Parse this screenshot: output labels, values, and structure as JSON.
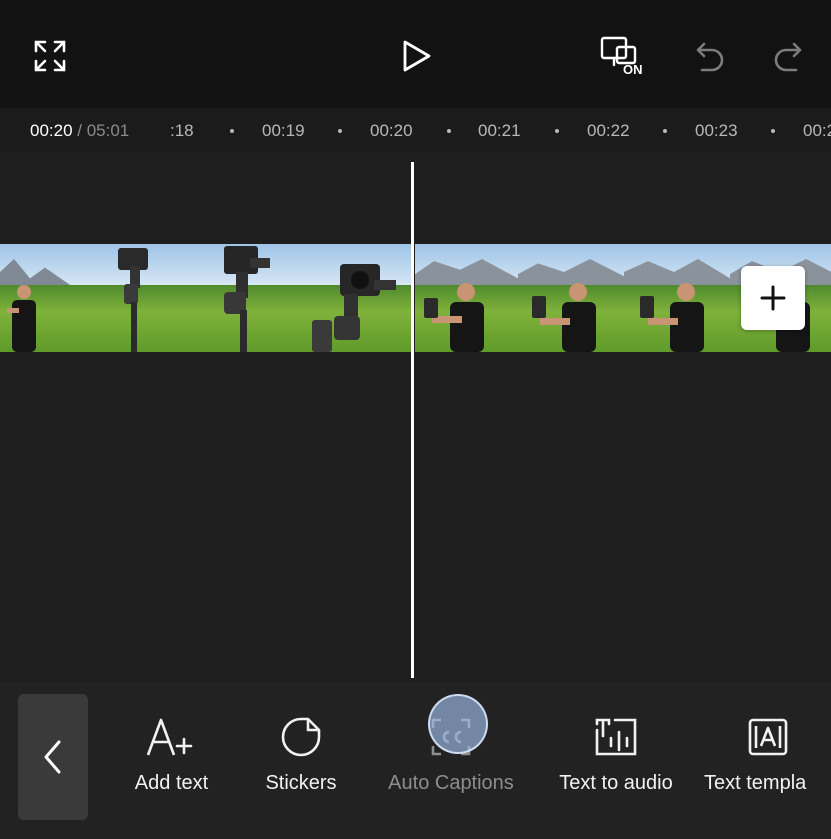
{
  "topbar": {
    "fullscreen_icon": "fullscreen-icon",
    "play_icon": "play-icon",
    "proxy_icon": "proxy-on-icon",
    "proxy_badge": "ON",
    "undo_icon": "undo-icon",
    "redo_icon": "redo-icon"
  },
  "timeline": {
    "current_time": "00:20",
    "separator": " / ",
    "total_time": "05:01",
    "ticks": [
      ":18",
      "00:19",
      "00:20",
      "00:21",
      "00:22",
      "00:23",
      "00:2"
    ]
  },
  "track": {
    "add_clip_icon": "plus-icon"
  },
  "toolbar": {
    "back_icon": "chevron-left-icon",
    "tools": [
      {
        "label": "Add text",
        "icon": "add-text-icon",
        "enabled": true
      },
      {
        "label": "Stickers",
        "icon": "sticker-icon",
        "enabled": true
      },
      {
        "label": "Auto Captions",
        "icon": "captions-icon",
        "enabled": false
      },
      {
        "label": "Text to audio",
        "icon": "text-to-audio-icon",
        "enabled": true
      },
      {
        "label": "Text templa",
        "icon": "text-template-icon",
        "enabled": true
      }
    ]
  },
  "colors": {
    "background": "#121212",
    "track_bg": "#1e1e1e",
    "toolbar_bg": "#222222",
    "playhead": "#ffffff",
    "disabled_text": "#8d8d8d"
  }
}
